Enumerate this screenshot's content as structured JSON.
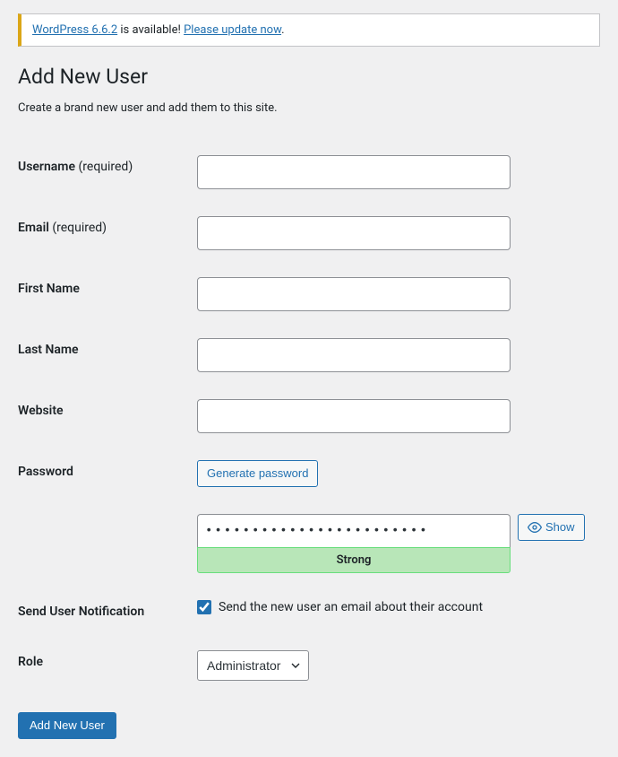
{
  "notice": {
    "link1_text": "WordPress 6.6.2",
    "middle_text": " is available! ",
    "link2_text": "Please update now",
    "end_text": "."
  },
  "page": {
    "title": "Add New User",
    "subtitle": "Create a brand new user and add them to this site."
  },
  "fields": {
    "username": {
      "label": "Username ",
      "required": "(required)",
      "value": ""
    },
    "email": {
      "label": "Email ",
      "required": "(required)",
      "value": ""
    },
    "first_name": {
      "label": "First Name",
      "value": ""
    },
    "last_name": {
      "label": "Last Name",
      "value": ""
    },
    "website": {
      "label": "Website",
      "value": ""
    },
    "password": {
      "label": "Password",
      "generate_button": "Generate password",
      "value": "••••••••••••••••••••••••",
      "show_button": "Show",
      "strength": "Strong"
    },
    "notification": {
      "label": "Send User Notification",
      "checkbox_label": "Send the new user an email about their account",
      "checked": true
    },
    "role": {
      "label": "Role",
      "selected": "Administrator"
    }
  },
  "submit": {
    "label": "Add New User"
  }
}
